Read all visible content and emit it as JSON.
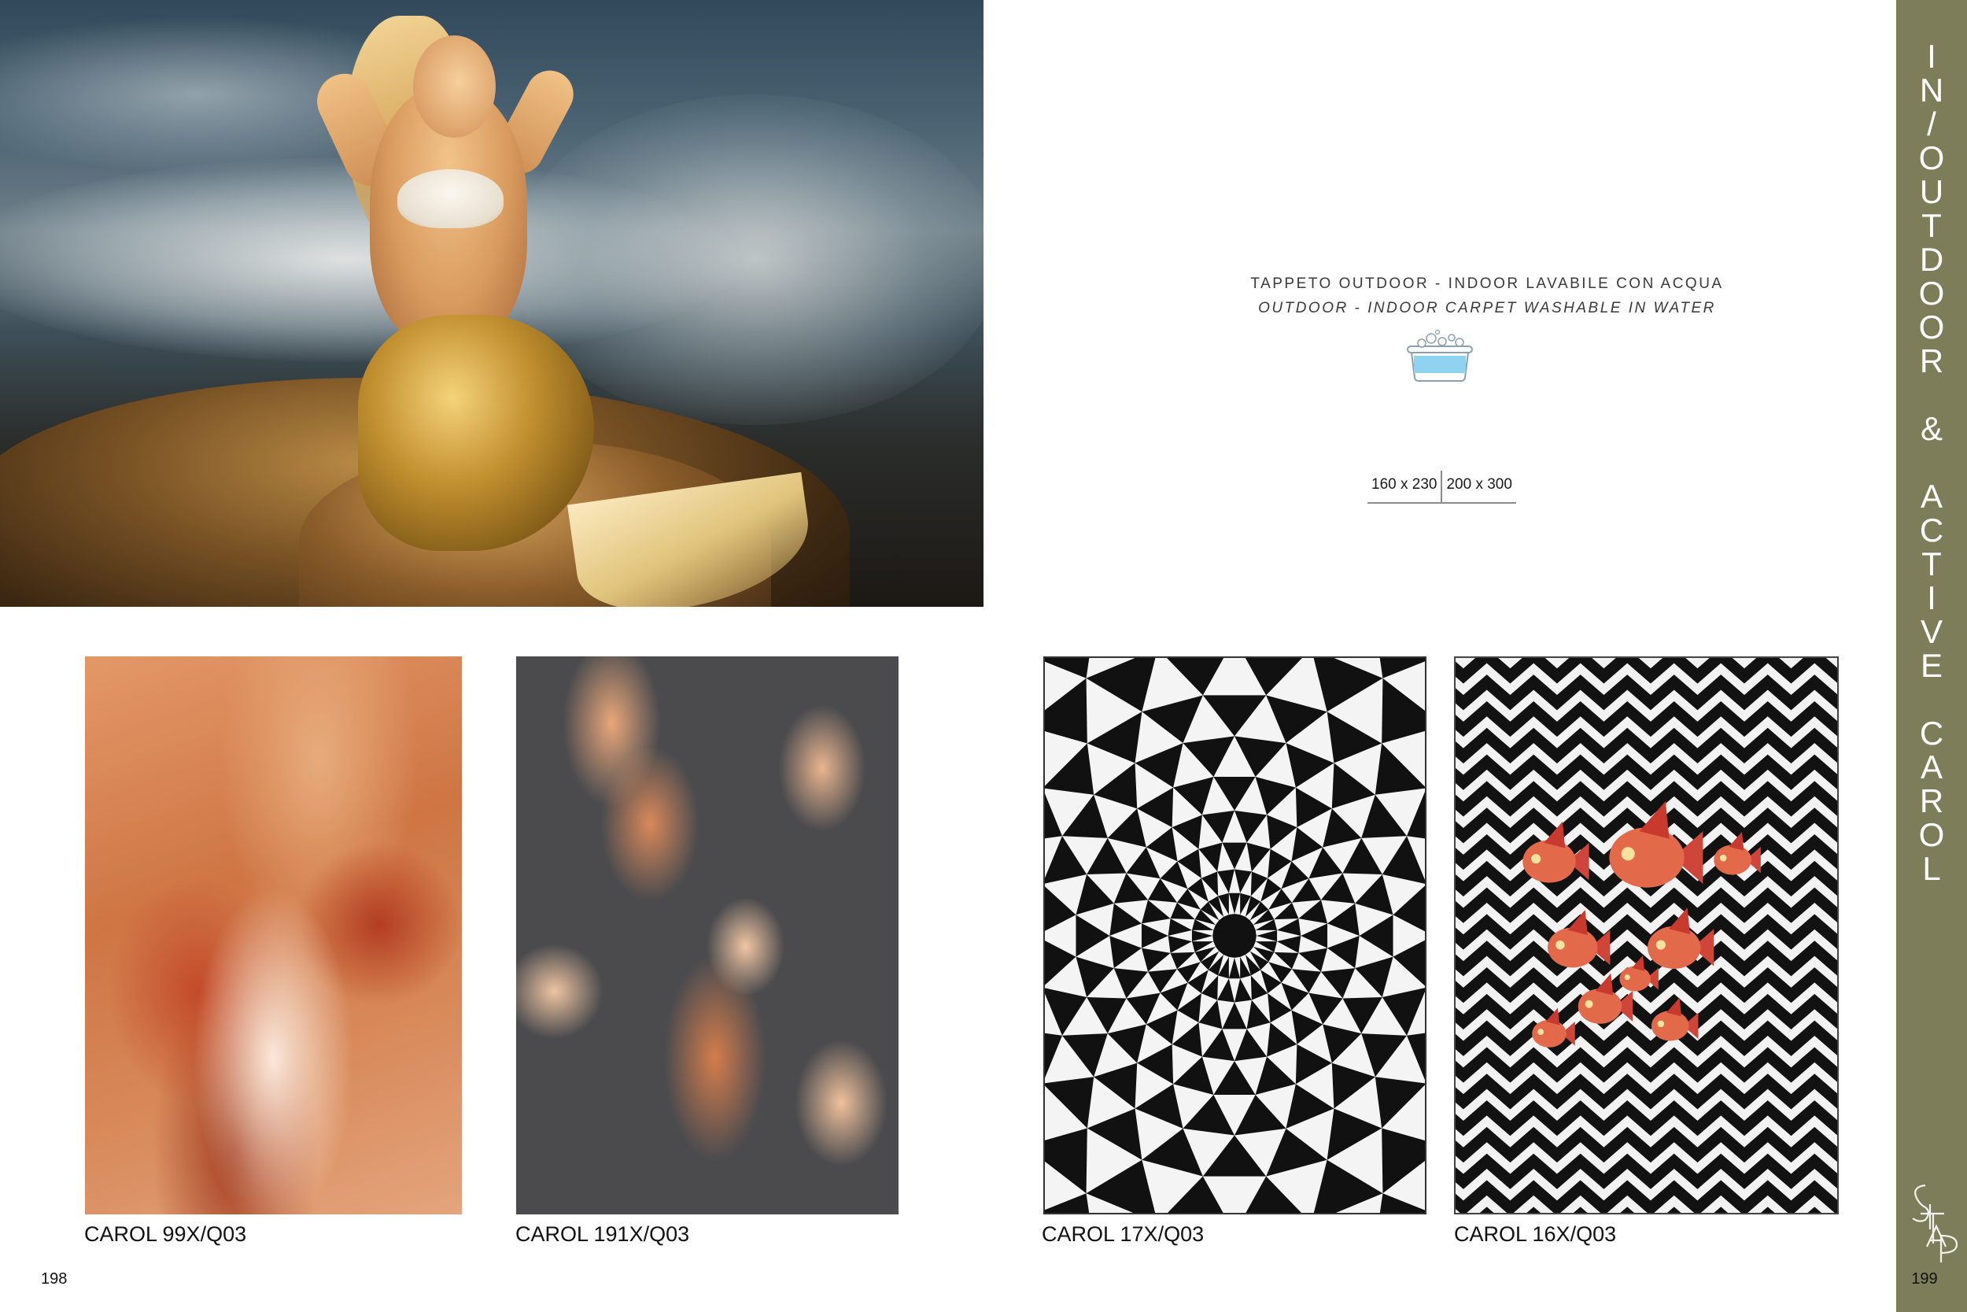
{
  "description": {
    "it": "TAPPETO OUTDOOR - INDOOR LAVABILE CON ACQUA",
    "en": "OUTDOOR - INDOOR CARPET WASHABLE IN WATER",
    "icon": "washable-basin-icon"
  },
  "sizes": [
    "160 x 230",
    "200 x 300"
  ],
  "products": [
    {
      "name": "CAROL 99X/Q03"
    },
    {
      "name": "CAROL 191X/Q03"
    },
    {
      "name": "CAROL 17X/Q03"
    },
    {
      "name": "CAROL 16X/Q03"
    }
  ],
  "pages": {
    "left": "198",
    "right": "199"
  },
  "sidetab": {
    "line1": "IN/OUTDOOR",
    "line2": "&",
    "line3": "ACTIVE",
    "line4": "CAROL",
    "color": "#7e7d5a"
  },
  "brand": {
    "logo_text": "SITAP"
  }
}
